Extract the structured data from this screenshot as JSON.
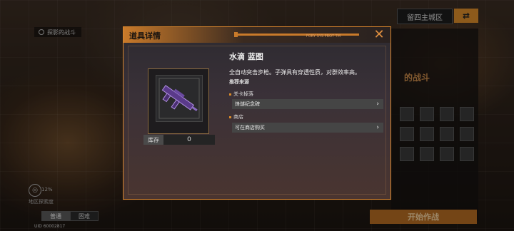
{
  "map": {
    "location_chip": "探影的战斗",
    "region_label": "留四主城区",
    "region_toggle_icon": "swap-icon"
  },
  "side_panel": {
    "title": "的战斗",
    "start_button": "开始作战"
  },
  "bottom_left": {
    "count": "12%",
    "area_text": "地区探索度",
    "mode_normal": "普通",
    "mode_hard": "困难",
    "uid": "UID 60002817"
  },
  "modal": {
    "title": "道具详情",
    "header_code": "FORY SYS PROT TM",
    "close_icon": "close-x-icon",
    "item": {
      "name": "水滴 蓝图",
      "description": "全自动突击步枪。子弹具有穿透性质，对群效率高。",
      "stock_label": "库存",
      "stock_value": "0"
    },
    "sources_title": "推荐来源",
    "sections": [
      {
        "label": "关卡掉落",
        "button": "烽燧纪念碑"
      },
      {
        "label": "商店",
        "button": "可在商店购买"
      }
    ]
  },
  "colors": {
    "accent": "#d98a2a",
    "modal_border": "#d9862e"
  }
}
